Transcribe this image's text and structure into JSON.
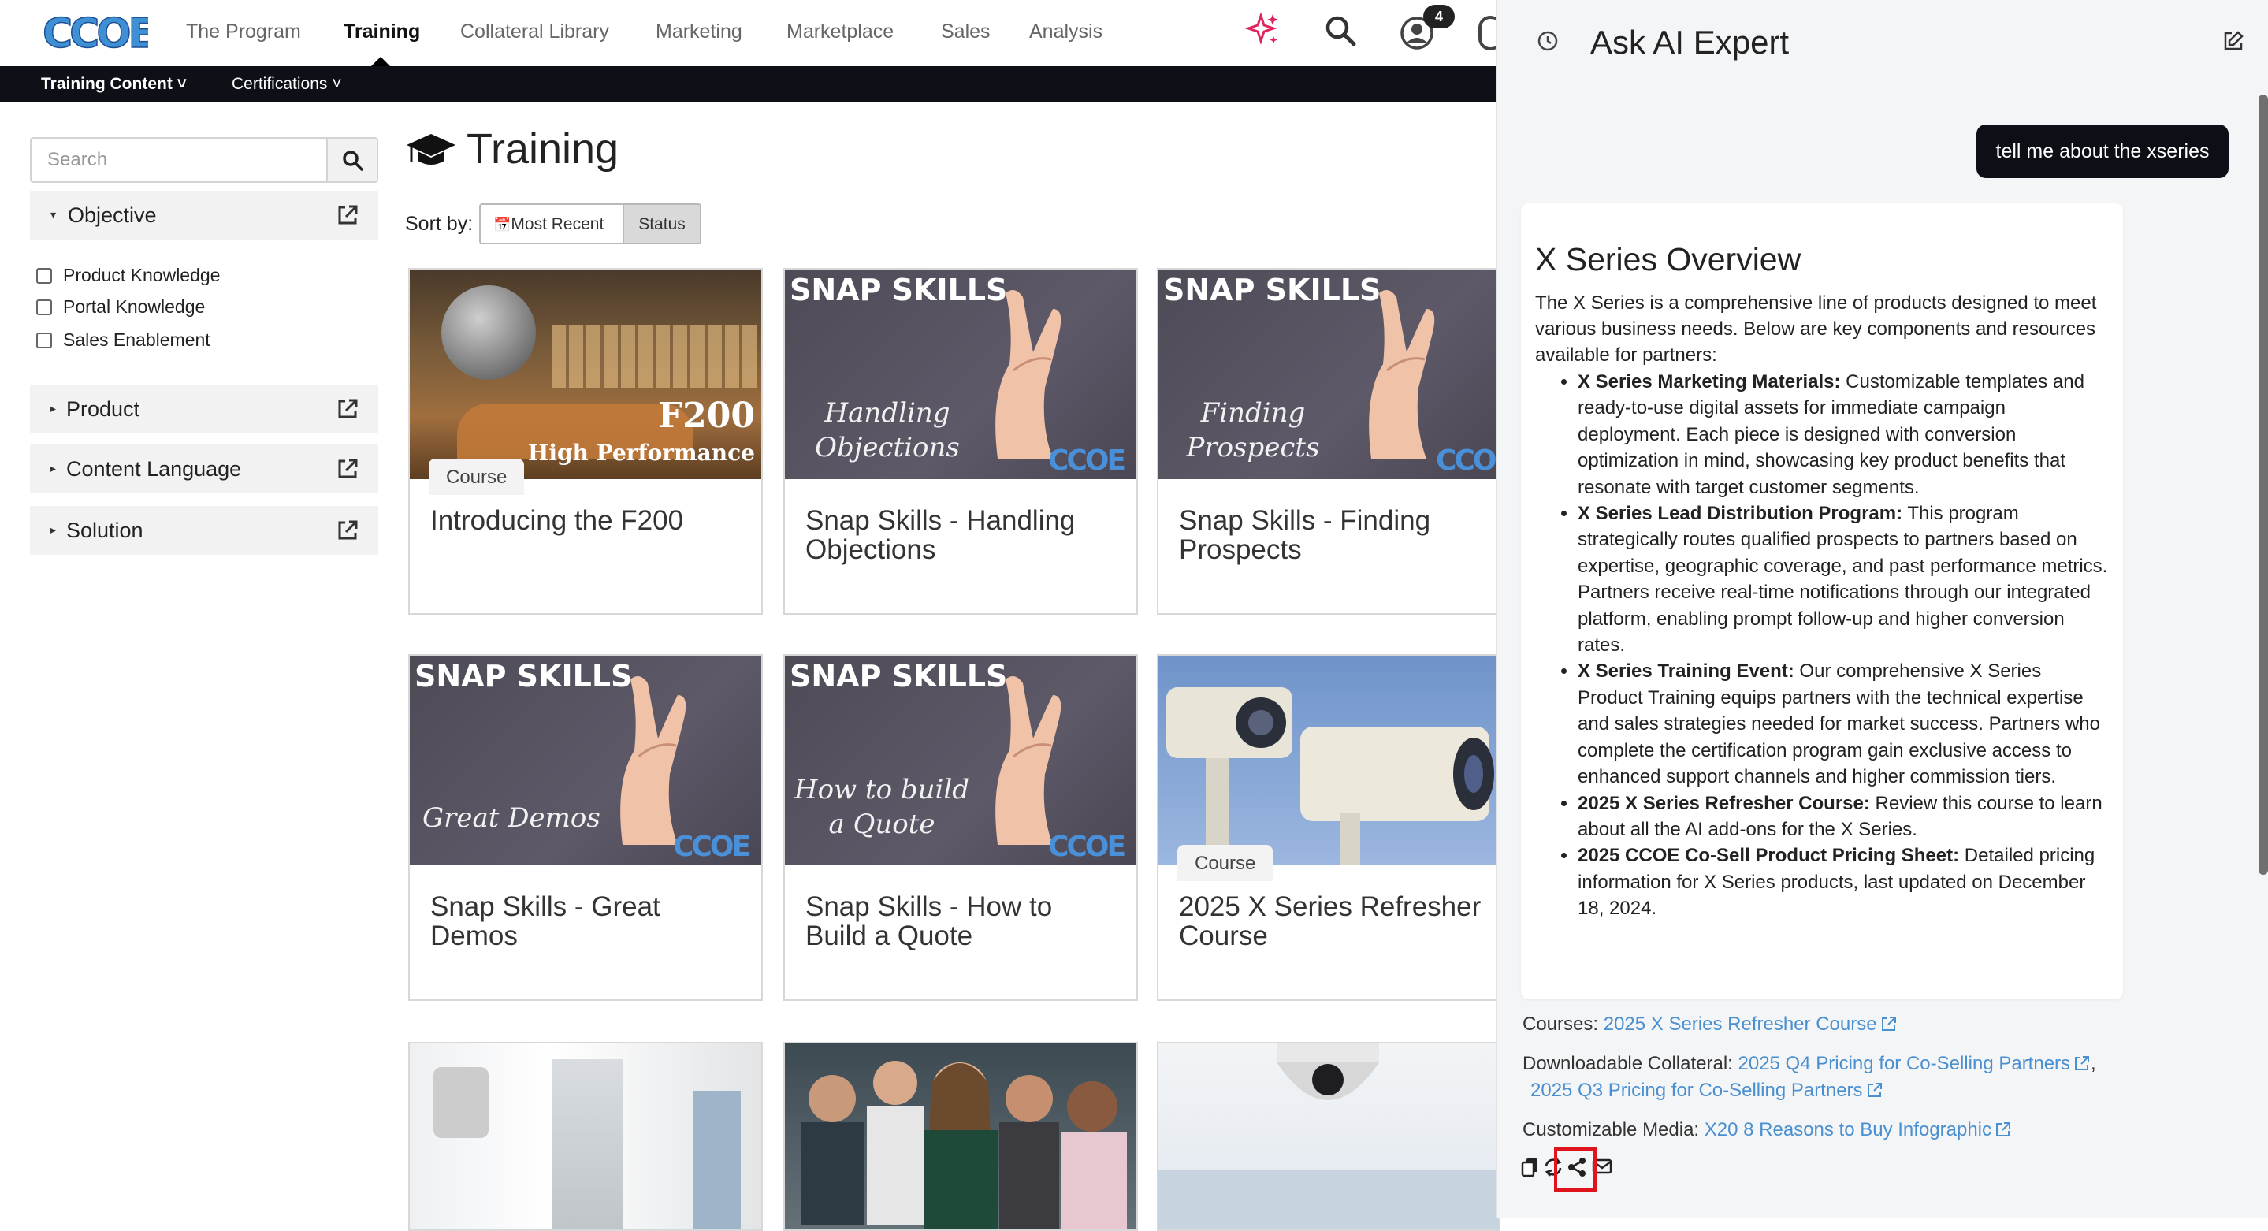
{
  "logo": {
    "text": "CCOE"
  },
  "nav": {
    "items": [
      {
        "label": "The Program"
      },
      {
        "label": "Training"
      },
      {
        "label": "Collateral Library"
      },
      {
        "label": "Marketing"
      },
      {
        "label": "Marketplace"
      },
      {
        "label": "Sales"
      },
      {
        "label": "Analysis"
      }
    ],
    "active": "Training",
    "notification_count": "4"
  },
  "subnav": {
    "items": [
      {
        "label": "Training Content"
      },
      {
        "label": "Certifications"
      }
    ]
  },
  "sidebar": {
    "search_placeholder": "Search",
    "facets": [
      {
        "label": "Objective",
        "expanded": true,
        "options": [
          "Product Knowledge",
          "Portal Knowledge",
          "Sales Enablement"
        ]
      },
      {
        "label": "Product",
        "expanded": false
      },
      {
        "label": "Content Language",
        "expanded": false
      },
      {
        "label": "Solution",
        "expanded": false
      }
    ]
  },
  "main": {
    "title": "Training",
    "sort_label": "Sort by:",
    "sort_options": [
      "Most Recent",
      "Status"
    ],
    "sort_selected": "Status",
    "cards": [
      {
        "title": "Introducing the F200",
        "badge": "Course",
        "thumb_text": [
          "F200",
          "High Performance"
        ]
      },
      {
        "title": "Snap Skills - Handling Objections",
        "thumb_head": "SNAP SKILLS",
        "thumb_sub": "Handling Objections"
      },
      {
        "title": "Snap Skills - Finding Prospects",
        "thumb_head": "SNAP SKILLS",
        "thumb_sub": "Finding Prospects"
      },
      {
        "title": "Snap Skills - Great Demos",
        "thumb_head": "SNAP SKILLS",
        "thumb_sub": "Great Demos"
      },
      {
        "title": "Snap Skills - How to Build a Quote",
        "thumb_head": "SNAP SKILLS",
        "thumb_sub": "How to build a Quote"
      },
      {
        "title": "2025 X Series Refresher Course",
        "badge": "Course"
      }
    ]
  },
  "ai": {
    "title": "Ask AI Expert",
    "user_message": "tell me about the xseries",
    "answer": {
      "heading": "X Series Overview",
      "intro": "The X Series is a comprehensive line of products designed to meet various business needs. Below are key components and resources available for partners:",
      "points": [
        {
          "title": "X Series Marketing Materials:",
          "text": " Customizable templates and ready-to-use digital assets for immediate campaign deployment. Each piece is designed with conversion optimization in mind, showcasing key product benefits that resonate with target customer segments."
        },
        {
          "title": "X Series Lead Distribution Program:",
          "text": " This program strategically routes qualified prospects to partners based on expertise, geographic coverage, and past performance metrics. Partners receive real-time notifications through our integrated platform, enabling prompt follow-up and higher conversion rates."
        },
        {
          "title": "X Series Training Event:",
          "text": " Our comprehensive X Series Product Training equips partners with the technical expertise and sales strategies needed for market success. Partners who complete the certification program gain exclusive access to enhanced support channels and higher commission tiers."
        },
        {
          "title": "2025 X Series Refresher Course:",
          "text": " Review this course to learn about all the AI add-ons for the X Series."
        },
        {
          "title": "2025 CCOE Co-Sell Product Pricing Sheet:",
          "text": " Detailed pricing information for X Series products, last updated on December 18, 2024."
        }
      ]
    },
    "resources": {
      "courses_label": "Courses:",
      "courses": [
        "2025 X Series Refresher Course"
      ],
      "collateral_label": "Downloadable Collateral:",
      "collateral": [
        "2025 Q4 Pricing for Co-Selling Partners",
        "2025 Q3 Pricing for Co-Selling Partners"
      ],
      "media_label": "Customizable Media:",
      "media": [
        "X20 8 Reasons to Buy Infographic"
      ]
    },
    "actions": [
      "copy-icon",
      "regenerate-icon",
      "share-icon",
      "email-icon"
    ]
  },
  "colors": {
    "nav_dark": "#0d1117",
    "link": "#4a8fd0",
    "ai_spark": "#e0245e",
    "highlight": "#e0141c"
  }
}
